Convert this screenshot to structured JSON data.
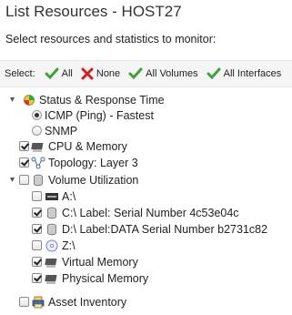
{
  "header": {
    "title": "List Resources - HOST27",
    "subtitle": "Select resources and statistics to monitor:"
  },
  "select_bar": {
    "label": "Select:",
    "buttons": [
      {
        "label": "All",
        "icon": "check-icon"
      },
      {
        "label": "None",
        "icon": "x-icon"
      },
      {
        "label": "All Volumes",
        "icon": "check-icon"
      },
      {
        "label": "All Interfaces",
        "icon": "check-icon"
      }
    ]
  },
  "tree": {
    "status": {
      "label": "Status & Response Time",
      "options": [
        {
          "label": "ICMP (Ping) - Fastest",
          "selected": true
        },
        {
          "label": "SNMP",
          "selected": false
        }
      ]
    },
    "cpu": {
      "label": "CPU & Memory",
      "checked": true
    },
    "topology": {
      "label": "Topology: Layer 3",
      "checked": true
    },
    "volume": {
      "label": "Volume Utilization",
      "checked": false,
      "items": [
        {
          "label": "A:\\",
          "checked": false,
          "icon": "floppy-drive-icon"
        },
        {
          "label": "C:\\ Label: Serial Number 4c53e04c",
          "checked": true,
          "icon": "disk-icon"
        },
        {
          "label": "D:\\ Label:DATA Serial Number b2731c82",
          "checked": true,
          "icon": "disk-icon"
        },
        {
          "label": "Z:\\",
          "checked": false,
          "icon": "cd-drive-icon"
        },
        {
          "label": "Virtual Memory",
          "checked": true,
          "icon": "memory-icon"
        },
        {
          "label": "Physical Memory",
          "checked": true,
          "icon": "memory-icon"
        }
      ]
    },
    "asset": {
      "label": "Asset Inventory",
      "checked": false
    }
  },
  "colors": {
    "check": "#3aa33a",
    "none": "#d21f1f",
    "bar_bg": "#f5f5f5"
  }
}
